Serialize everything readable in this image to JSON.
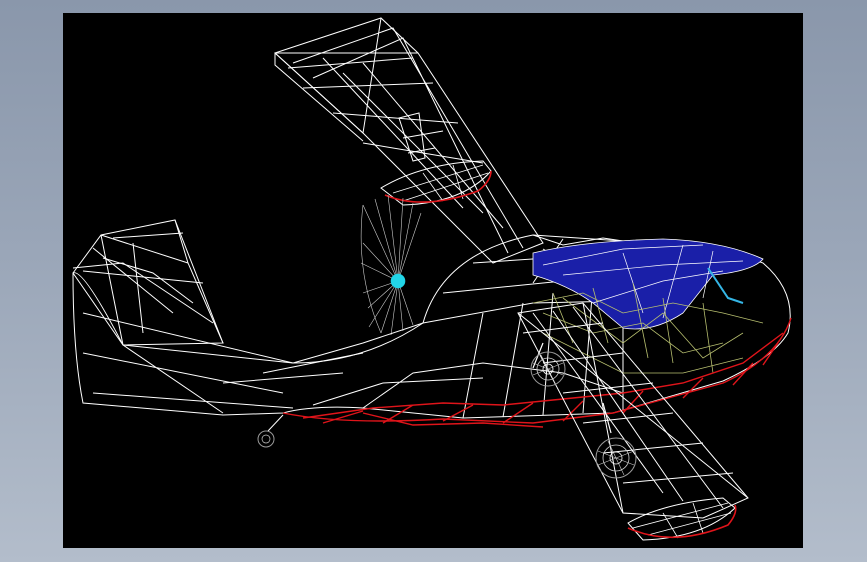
{
  "app": {
    "background_gradient": [
      "#8a97ab",
      "#b3bdcb"
    ]
  },
  "viewport": {
    "background": "#000000",
    "render_mode": "wireframe"
  },
  "model": {
    "subject": "amphibious-aircraft-wireframe",
    "colors": {
      "airframe": "#ffffff",
      "hull_bottom": "#e0141a",
      "canopy": "#1a1fa8",
      "interior_frame": "#b8c070",
      "spinner": "#22d6e8",
      "landing_gear": "#9a9a9a",
      "window_accent": "#35b6e6"
    },
    "icons": [
      "aircraft-wireframe-icon"
    ]
  }
}
